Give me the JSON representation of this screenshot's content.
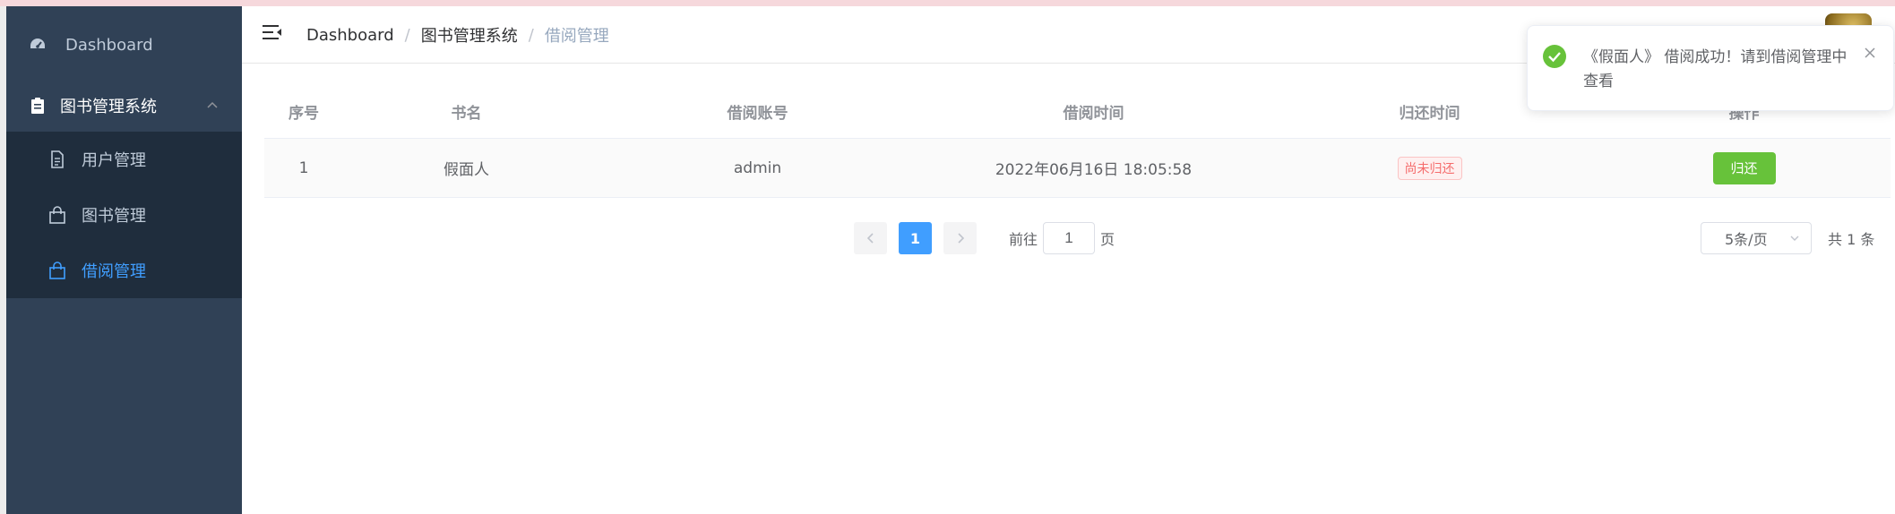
{
  "sidebar": {
    "dashboard": "Dashboard",
    "parent": "图书管理系统",
    "items": [
      {
        "label": "用户管理"
      },
      {
        "label": "图书管理"
      },
      {
        "label": "借阅管理"
      }
    ]
  },
  "header": {
    "breadcrumb": [
      "Dashboard",
      "图书管理系统",
      "借阅管理"
    ],
    "separator": "/"
  },
  "table": {
    "headers": [
      "序号",
      "书名",
      "借阅账号",
      "借阅时间",
      "归还时间",
      "操作"
    ],
    "rows": [
      {
        "index": "1",
        "title": "假面人",
        "account": "admin",
        "time": "2022年06月16日 18:05:58",
        "status": "尚未归还",
        "action": "归还"
      }
    ]
  },
  "pagination": {
    "current": "1",
    "goto_prefix": "前往",
    "goto_value": "1",
    "goto_suffix": "页",
    "page_size": "5条/页",
    "total": "共 1 条"
  },
  "toast": {
    "message": "《假面人》 借阅成功！请到借阅管理中查看"
  },
  "colors": {
    "sidebar_bg": "#304156",
    "sidebar_sub_bg": "#1f2d3d",
    "accent": "#409eff",
    "success": "#67c23a",
    "danger": "#f56c6c"
  }
}
